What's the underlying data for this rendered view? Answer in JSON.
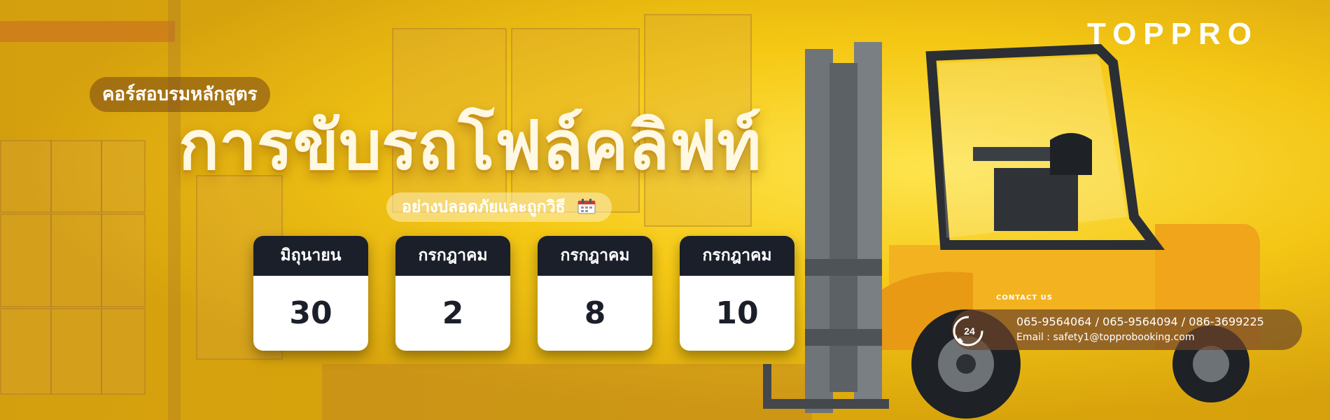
{
  "brand": {
    "logo_text": "TOPPRO"
  },
  "headline": {
    "kicker": "คอร์สอบรมหลักสูตร",
    "title": "การขับรถโฟล์คลิฟท์",
    "subtitle": "อย่างปลอดภัยและถูกวิธี"
  },
  "schedule": [
    {
      "month": "มิถุนายน",
      "day": "30"
    },
    {
      "month": "กรกฎาคม",
      "day": "2"
    },
    {
      "month": "กรกฎาคม",
      "day": "8"
    },
    {
      "month": "กรกฎาคม",
      "day": "10"
    }
  ],
  "contact": {
    "label": "CONTACT US",
    "badge": "24",
    "phones": "065-9564064 / 065-9564094 / 086-3699225",
    "email": "Email : safety1@topprobooking.com"
  },
  "colors": {
    "accent": "#f3cf12",
    "card_header": "#1b1f2a",
    "forklift_body": "#f0a51a"
  }
}
